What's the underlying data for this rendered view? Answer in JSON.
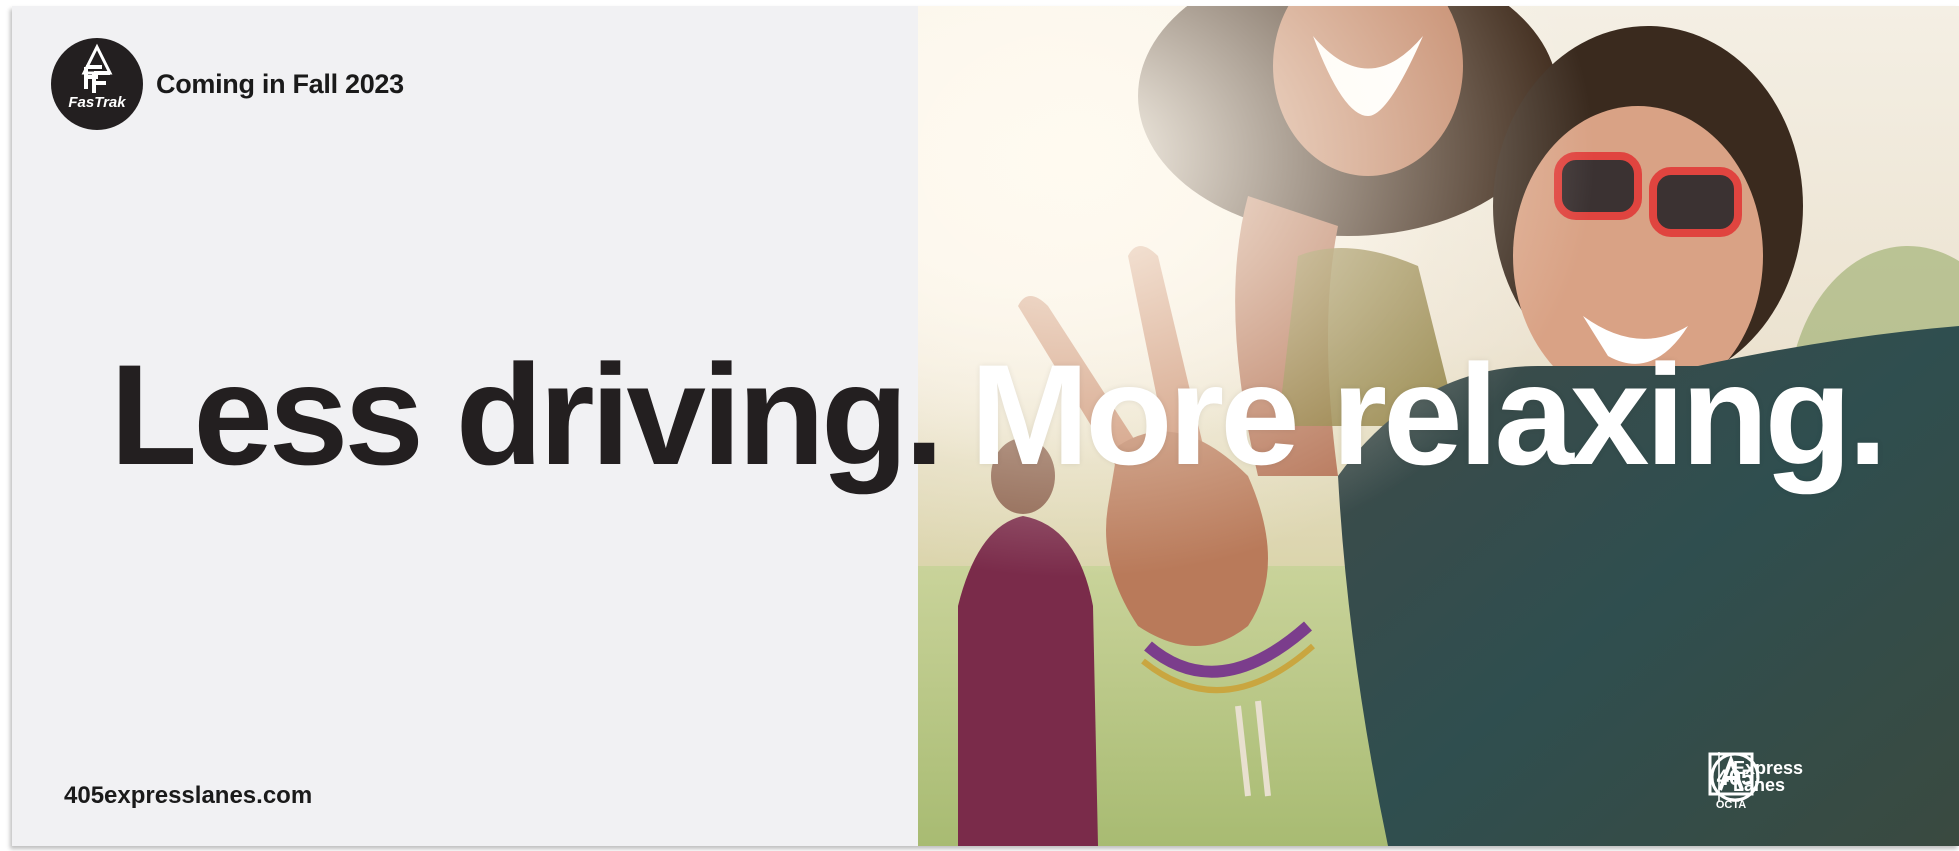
{
  "header": {
    "logo_name": "fastrak-logo",
    "logo_text": "FasTrak",
    "tagline": "Coming in Fall 2023"
  },
  "headline": {
    "part1": "Less driving.",
    "part2": "More relaxing."
  },
  "footer": {
    "url": "405expresslanes.com",
    "octa_label": "OCTA",
    "express_number": "405",
    "express_line1": "Express",
    "express_line2": "Lanes"
  },
  "colors": {
    "left_background": "#f1f1f3",
    "headline_dark": "#231f20",
    "headline_light": "#ffffff",
    "logo_circle": "#231f20"
  }
}
